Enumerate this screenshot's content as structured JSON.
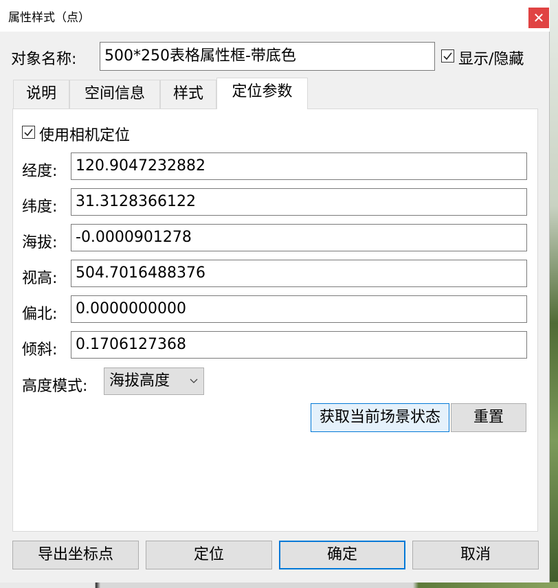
{
  "window": {
    "title": "属性样式（点）",
    "close_glyph": "✕"
  },
  "object": {
    "name_label": "对象名称:",
    "name_value": "500*250表格属性框-带底色",
    "show_hide_label": "显示/隐藏",
    "show_hide_checked": true
  },
  "tabs": [
    {
      "label": "说明",
      "active": false
    },
    {
      "label": "空间信息",
      "active": false
    },
    {
      "label": "样式",
      "active": false
    },
    {
      "label": "定位参数",
      "active": true
    }
  ],
  "positioning": {
    "use_camera_label": "使用相机定位",
    "use_camera_checked": true,
    "fields": [
      {
        "label": "经度:",
        "value": "120.9047232882"
      },
      {
        "label": "纬度:",
        "value": "31.3128366122"
      },
      {
        "label": "海拔:",
        "value": "-0.0000901278"
      },
      {
        "label": "视高:",
        "value": "504.7016488376"
      },
      {
        "label": "偏北:",
        "value": "0.0000000000"
      },
      {
        "label": "倾斜:",
        "value": "0.1706127368"
      }
    ],
    "altitude_mode_label": "高度模式:",
    "altitude_mode_value": "海拔高度",
    "get_scene_button": "获取当前场景状态",
    "reset_button": "重置"
  },
  "footer": {
    "export_button": "导出坐标点",
    "locate_button": "定位",
    "ok_button": "确定",
    "cancel_button": "取消"
  },
  "colors": {
    "accent": "#0078d7",
    "close_red": "#e04343"
  },
  "icons": {
    "check": "checkmark-icon",
    "dropdown": "chevron-down-icon",
    "close": "close-icon"
  }
}
